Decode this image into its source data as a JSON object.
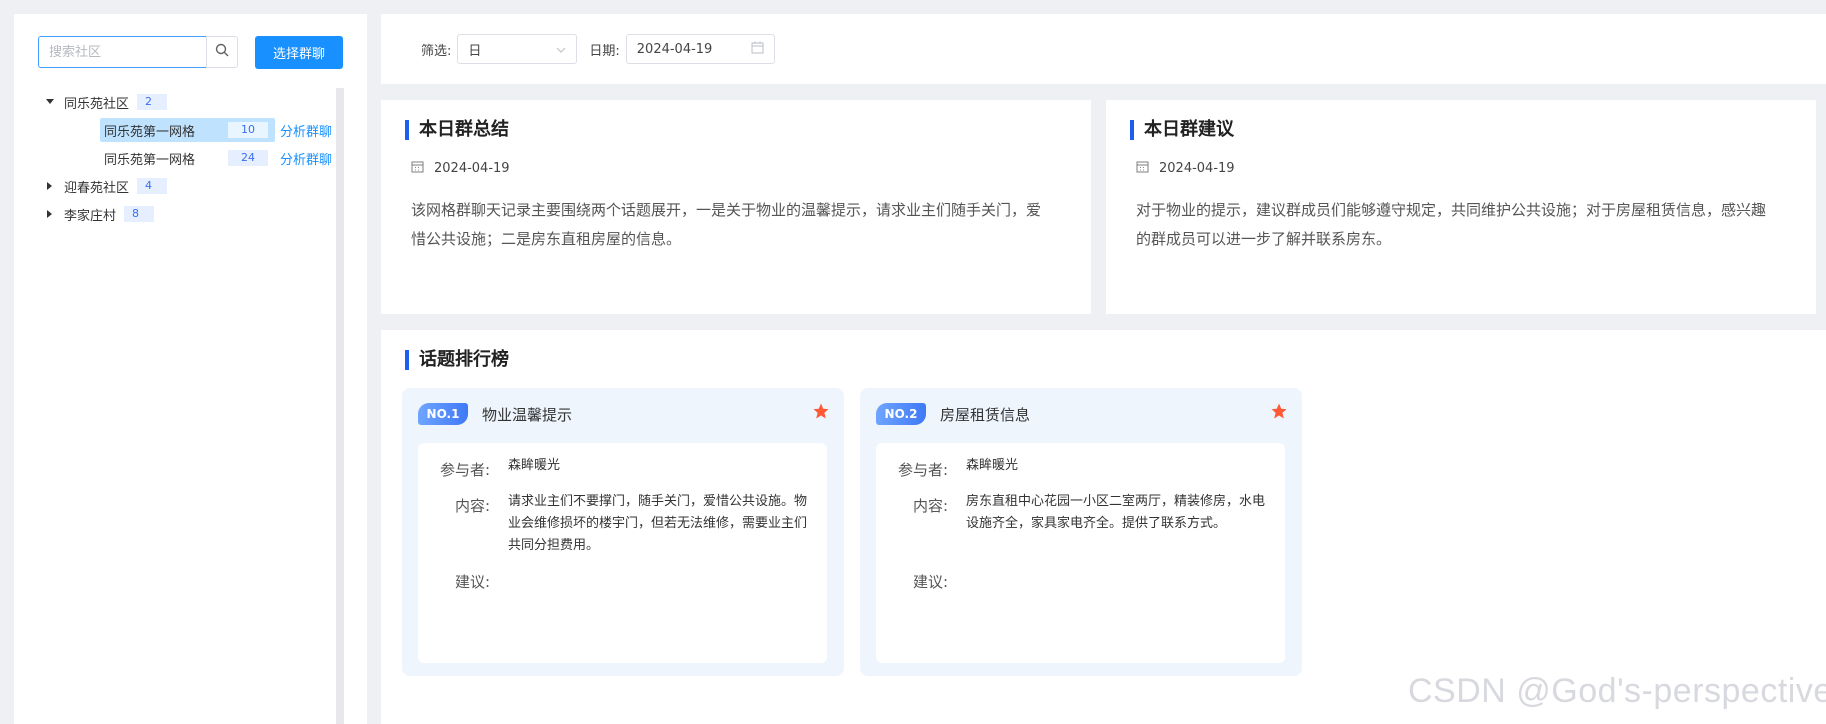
{
  "sidebar": {
    "search_placeholder": "搜索社区",
    "select_group_label": "选择群聊",
    "tree": [
      {
        "label": "同乐苑社区",
        "count": "2",
        "expanded": true,
        "children": [
          {
            "label": "同乐苑第一网格",
            "count": "10",
            "action": "分析群聊",
            "selected": true
          },
          {
            "label": "同乐苑第一网格",
            "count": "24",
            "action": "分析群聊",
            "selected": false
          }
        ]
      },
      {
        "label": "迎春苑社区",
        "count": "4",
        "expanded": false
      },
      {
        "label": "李家庄村",
        "count": "8",
        "expanded": false
      }
    ]
  },
  "filter": {
    "filter_label": "筛选:",
    "filter_value": "日",
    "date_label": "日期:",
    "date_value": "2024-04-19"
  },
  "summary": {
    "title": "本日群总结",
    "date": "2024-04-19",
    "text": "该网格群聊天记录主要围绕两个话题展开，一是关于物业的温馨提示，请求业主们随手关门，爱惜公共设施；二是房东直租房屋的信息。"
  },
  "suggestion": {
    "title": "本日群建议",
    "date": "2024-04-19",
    "text": "对于物业的提示，建议群成员们能够遵守规定，共同维护公共设施；对于房屋租赁信息，感兴趣的群成员可以进一步了解并联系房东。"
  },
  "ranking": {
    "title": "话题排行榜",
    "topics": [
      {
        "badge": "NO.1",
        "name": "物业温馨提示",
        "participants_label": "参与者:",
        "participants": "森眸暖光",
        "content_label": "内容:",
        "content": "请求业主们不要撑门，随手关门，爱惜公共设施。物业会维修损坏的楼宇门，但若无法维修，需要业主们共同分担费用。",
        "advice_label": "建议:",
        "advice": ""
      },
      {
        "badge": "NO.2",
        "name": "房屋租赁信息",
        "participants_label": "参与者:",
        "participants": "森眸暖光",
        "content_label": "内容:",
        "content": "房东直租中心花园一小区二室两厅，精装修房，水电设施齐全，家具家电齐全。提供了联系方式。",
        "advice_label": "建议:",
        "advice": ""
      }
    ]
  },
  "watermark": "CSDN @God's-perspective",
  "colors": {
    "accent": "#1890ff",
    "title_bar": "#1d5df2",
    "star": "#ff5a36",
    "selected_bg": "#bfe3ff"
  },
  "icons": {
    "search": "search-icon",
    "calendar": "calendar-icon",
    "star": "star-icon",
    "caret": "caret-icon"
  }
}
